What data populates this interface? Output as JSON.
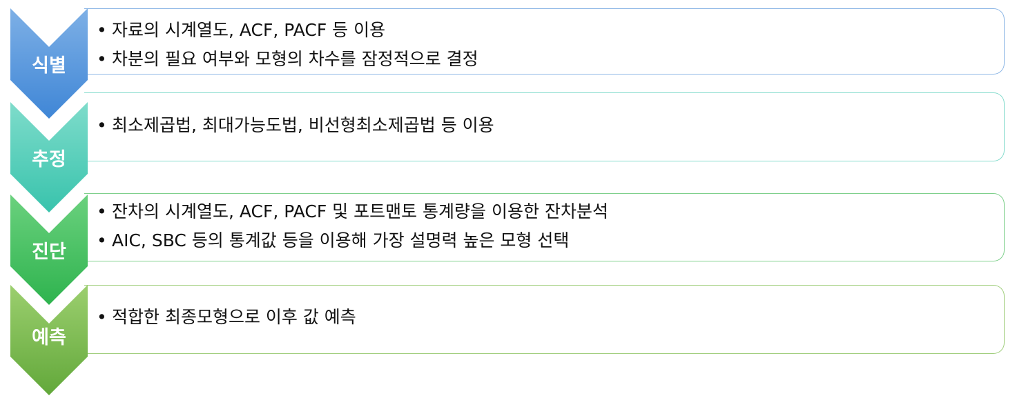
{
  "stages": [
    {
      "label": "식별",
      "colors": {
        "top": "#7eb0e6",
        "bottom": "#3f86d6",
        "border": "#8fb8e6"
      },
      "bullets": [
        "자료의 시계열도, ACF, PACF 등 이용",
        "차분의 필요 여부와 모형의 차수를 잠정적으로 결정"
      ]
    },
    {
      "label": "추정",
      "colors": {
        "top": "#7fdccb",
        "bottom": "#38c3ac",
        "border": "#86dccd"
      },
      "bullets": [
        "최소제곱법, 최대가능도법, 비선형최소제곱법 등 이용"
      ]
    },
    {
      "label": "진단",
      "colors": {
        "top": "#6bd17e",
        "bottom": "#2eb34e",
        "border": "#7fd08c"
      },
      "bullets": [
        "잔차의 시계열도, ACF, PACF 및 포트맨토 통계량을 이용한 잔차분석",
        "AIC, SBC 등의 통계값 등을 이용해 가장 설명력 높은 모형 선택"
      ]
    },
    {
      "label": "예측",
      "colors": {
        "top": "#9ccf6f",
        "bottom": "#62a83a",
        "border": "#a2cf7f"
      },
      "bullets": [
        "적합한 최종모형으로 이후 값 예측"
      ]
    }
  ],
  "bullet_char": "•"
}
